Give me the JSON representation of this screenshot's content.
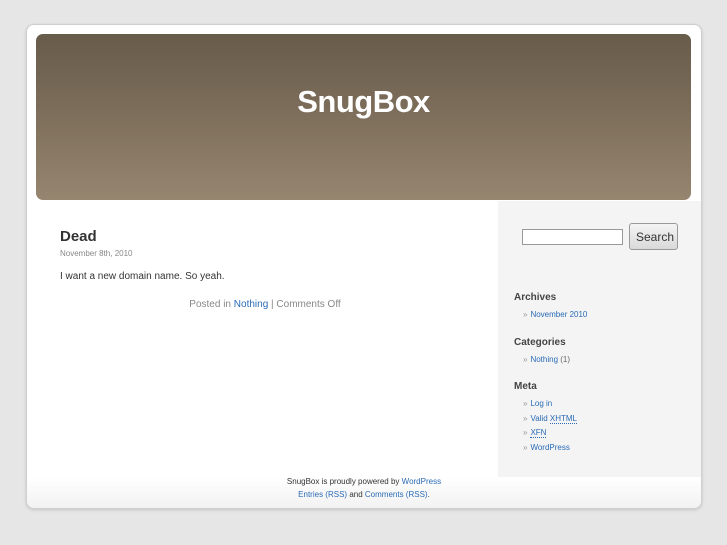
{
  "header": {
    "blog_title": "SnugBox"
  },
  "post": {
    "title": "Dead",
    "date": "November 8th, 2010",
    "body": "I want a new domain name. So yeah.",
    "posted_in_label": "Posted in",
    "category_link": "Nothing",
    "separator": "|",
    "comments_status": "Comments Off"
  },
  "sidebar": {
    "search": {
      "placeholder": "",
      "button_label": "Search"
    },
    "archives": {
      "title": "Archives",
      "items": [
        "November 2010"
      ]
    },
    "categories": {
      "title": "Categories",
      "items": [
        {
          "label": "Nothing",
          "count": "(1)"
        }
      ]
    },
    "meta": {
      "title": "Meta",
      "items": [
        "Log in",
        "Valid",
        "XHTML",
        "XFN",
        "WordPress"
      ]
    },
    "bullet": "»"
  },
  "footer": {
    "powered_prefix": "SnugBox is proudly powered by",
    "powered_link": "WordPress",
    "entries_link": "Entries (RSS)",
    "and_text": "and",
    "comments_link": "Comments (RSS)",
    "end_text": "."
  }
}
